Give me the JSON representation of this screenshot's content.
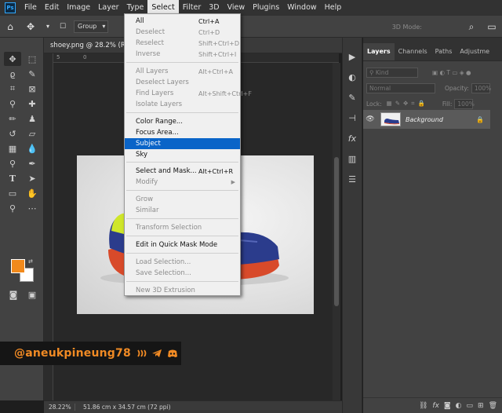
{
  "menubar": {
    "logo": "Ps",
    "items": [
      "File",
      "Edit",
      "Image",
      "Layer",
      "Type",
      "Select",
      "Filter",
      "3D",
      "View",
      "Plugins",
      "Window",
      "Help"
    ],
    "active": "Select"
  },
  "optbar": {
    "autoselect_value": "Group",
    "mode_3d": "3D Mode:"
  },
  "document": {
    "tab_title": "shoey.png @ 28.2% (RGB",
    "ruler_ticks": [
      "5",
      "0"
    ],
    "zoom": "28.22%",
    "doc_size": "51.86 cm x 34.57 cm (72 ppi)"
  },
  "colors": {
    "foreground": "#f28a1c",
    "background": "#ffffff",
    "menu_highlight": "#0a64c8"
  },
  "select_menu": {
    "items": [
      {
        "label": "All",
        "shortcut": "Ctrl+A",
        "disabled": false
      },
      {
        "label": "Deselect",
        "shortcut": "Ctrl+D",
        "disabled": true
      },
      {
        "label": "Reselect",
        "shortcut": "Shift+Ctrl+D",
        "disabled": true
      },
      {
        "label": "Inverse",
        "shortcut": "Shift+Ctrl+I",
        "disabled": true
      },
      {
        "label": "All Layers",
        "shortcut": "Alt+Ctrl+A",
        "disabled": true
      },
      {
        "label": "Deselect Layers",
        "shortcut": "",
        "disabled": true
      },
      {
        "label": "Find Layers",
        "shortcut": "Alt+Shift+Ctrl+F",
        "disabled": true
      },
      {
        "label": "Isolate Layers",
        "shortcut": "",
        "disabled": true
      },
      {
        "label": "Color Range...",
        "shortcut": "",
        "disabled": false
      },
      {
        "label": "Focus Area...",
        "shortcut": "",
        "disabled": false
      },
      {
        "label": "Subject",
        "shortcut": "",
        "disabled": false,
        "highlighted": true
      },
      {
        "label": "Sky",
        "shortcut": "",
        "disabled": false
      },
      {
        "label": "Select and Mask...",
        "shortcut": "Alt+Ctrl+R",
        "disabled": false
      },
      {
        "label": "Modify",
        "shortcut": "",
        "disabled": true,
        "submenu": true
      },
      {
        "label": "Grow",
        "shortcut": "",
        "disabled": true
      },
      {
        "label": "Similar",
        "shortcut": "",
        "disabled": true
      },
      {
        "label": "Transform Selection",
        "shortcut": "",
        "disabled": true
      },
      {
        "label": "Edit in Quick Mask Mode",
        "shortcut": "",
        "disabled": false
      },
      {
        "label": "Load Selection...",
        "shortcut": "",
        "disabled": true
      },
      {
        "label": "Save Selection...",
        "shortcut": "",
        "disabled": true
      },
      {
        "label": "New 3D Extrusion",
        "shortcut": "",
        "disabled": true
      }
    ]
  },
  "layers_panel": {
    "tabs": [
      "Layers",
      "Channels",
      "Paths",
      "Adjustme"
    ],
    "active_tab": "Layers",
    "filter_kind": "Kind",
    "blend_mode": "Normal",
    "opacity_label": "Opacity:",
    "opacity_value": "100%",
    "lock_label": "Lock:",
    "fill_label": "Fill:",
    "fill_value": "100%",
    "layer_name": "Background"
  },
  "watermark": {
    "handle": "@aneukpineung78"
  }
}
